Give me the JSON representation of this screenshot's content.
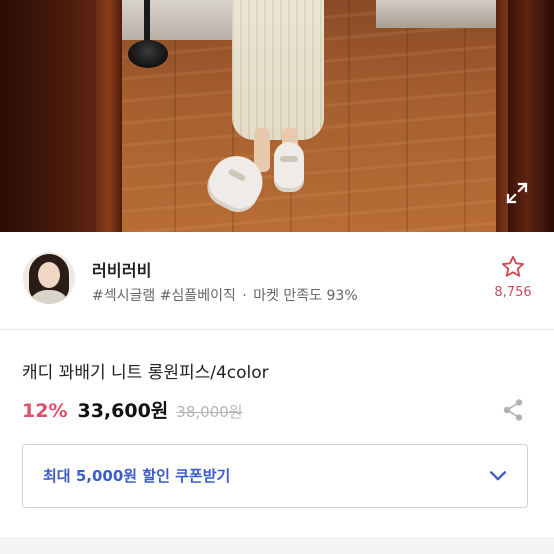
{
  "product_image": {
    "alt": "",
    "expand_icon": "expand-icon"
  },
  "seller": {
    "name": "러비러비",
    "tags": "#섹시글램 #심플베이직",
    "separator": "·",
    "satisfaction": "마켓 만족도 93%",
    "favorite_icon": "star-outline-icon",
    "favorite_count": "8,756"
  },
  "product": {
    "title": "캐디 꽈배기 니트 롱원피스/4color",
    "discount": "12%",
    "price": "33,600원",
    "original_price": "38,000원",
    "share_icon": "share-icon"
  },
  "coupon": {
    "label": "최대 5,000원 할인 쿠폰받기",
    "icon": "chevron-down-icon"
  },
  "colors": {
    "discount": "#e0506a",
    "favorite": "#d04a5c",
    "coupon_text": "#3b5cc9",
    "coupon_border": "#c9d3e8"
  }
}
